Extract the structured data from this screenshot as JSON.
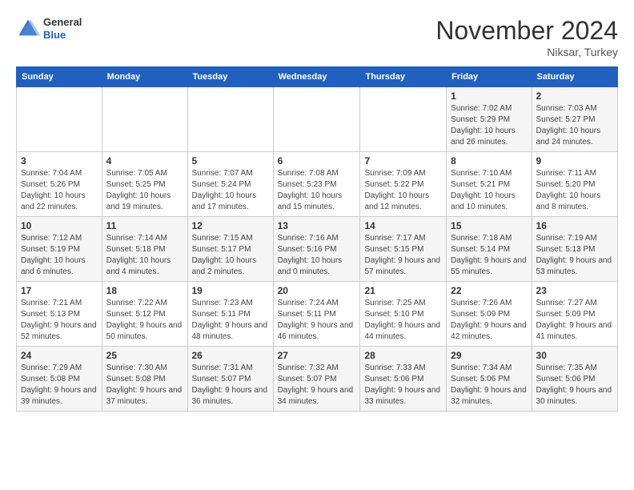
{
  "logo": {
    "general": "General",
    "blue": "Blue"
  },
  "header": {
    "month": "November 2024",
    "location": "Niksar, Turkey"
  },
  "weekdays": [
    "Sunday",
    "Monday",
    "Tuesday",
    "Wednesday",
    "Thursday",
    "Friday",
    "Saturday"
  ],
  "weeks": [
    [
      {
        "day": "",
        "info": ""
      },
      {
        "day": "",
        "info": ""
      },
      {
        "day": "",
        "info": ""
      },
      {
        "day": "",
        "info": ""
      },
      {
        "day": "",
        "info": ""
      },
      {
        "day": "1",
        "info": "Sunrise: 7:02 AM\nSunset: 5:29 PM\nDaylight: 10 hours and 26 minutes."
      },
      {
        "day": "2",
        "info": "Sunrise: 7:03 AM\nSunset: 5:27 PM\nDaylight: 10 hours and 24 minutes."
      }
    ],
    [
      {
        "day": "3",
        "info": "Sunrise: 7:04 AM\nSunset: 5:26 PM\nDaylight: 10 hours and 22 minutes."
      },
      {
        "day": "4",
        "info": "Sunrise: 7:05 AM\nSunset: 5:25 PM\nDaylight: 10 hours and 19 minutes."
      },
      {
        "day": "5",
        "info": "Sunrise: 7:07 AM\nSunset: 5:24 PM\nDaylight: 10 hours and 17 minutes."
      },
      {
        "day": "6",
        "info": "Sunrise: 7:08 AM\nSunset: 5:23 PM\nDaylight: 10 hours and 15 minutes."
      },
      {
        "day": "7",
        "info": "Sunrise: 7:09 AM\nSunset: 5:22 PM\nDaylight: 10 hours and 12 minutes."
      },
      {
        "day": "8",
        "info": "Sunrise: 7:10 AM\nSunset: 5:21 PM\nDaylight: 10 hours and 10 minutes."
      },
      {
        "day": "9",
        "info": "Sunrise: 7:11 AM\nSunset: 5:20 PM\nDaylight: 10 hours and 8 minutes."
      }
    ],
    [
      {
        "day": "10",
        "info": "Sunrise: 7:12 AM\nSunset: 5:19 PM\nDaylight: 10 hours and 6 minutes."
      },
      {
        "day": "11",
        "info": "Sunrise: 7:14 AM\nSunset: 5:18 PM\nDaylight: 10 hours and 4 minutes."
      },
      {
        "day": "12",
        "info": "Sunrise: 7:15 AM\nSunset: 5:17 PM\nDaylight: 10 hours and 2 minutes."
      },
      {
        "day": "13",
        "info": "Sunrise: 7:16 AM\nSunset: 5:16 PM\nDaylight: 10 hours and 0 minutes."
      },
      {
        "day": "14",
        "info": "Sunrise: 7:17 AM\nSunset: 5:15 PM\nDaylight: 9 hours and 57 minutes."
      },
      {
        "day": "15",
        "info": "Sunrise: 7:18 AM\nSunset: 5:14 PM\nDaylight: 9 hours and 55 minutes."
      },
      {
        "day": "16",
        "info": "Sunrise: 7:19 AM\nSunset: 5:13 PM\nDaylight: 9 hours and 53 minutes."
      }
    ],
    [
      {
        "day": "17",
        "info": "Sunrise: 7:21 AM\nSunset: 5:13 PM\nDaylight: 9 hours and 52 minutes."
      },
      {
        "day": "18",
        "info": "Sunrise: 7:22 AM\nSunset: 5:12 PM\nDaylight: 9 hours and 50 minutes."
      },
      {
        "day": "19",
        "info": "Sunrise: 7:23 AM\nSunset: 5:11 PM\nDaylight: 9 hours and 48 minutes."
      },
      {
        "day": "20",
        "info": "Sunrise: 7:24 AM\nSunset: 5:11 PM\nDaylight: 9 hours and 46 minutes."
      },
      {
        "day": "21",
        "info": "Sunrise: 7:25 AM\nSunset: 5:10 PM\nDaylight: 9 hours and 44 minutes."
      },
      {
        "day": "22",
        "info": "Sunrise: 7:26 AM\nSunset: 5:09 PM\nDaylight: 9 hours and 42 minutes."
      },
      {
        "day": "23",
        "info": "Sunrise: 7:27 AM\nSunset: 5:09 PM\nDaylight: 9 hours and 41 minutes."
      }
    ],
    [
      {
        "day": "24",
        "info": "Sunrise: 7:29 AM\nSunset: 5:08 PM\nDaylight: 9 hours and 39 minutes."
      },
      {
        "day": "25",
        "info": "Sunrise: 7:30 AM\nSunset: 5:08 PM\nDaylight: 9 hours and 37 minutes."
      },
      {
        "day": "26",
        "info": "Sunrise: 7:31 AM\nSunset: 5:07 PM\nDaylight: 9 hours and 36 minutes."
      },
      {
        "day": "27",
        "info": "Sunrise: 7:32 AM\nSunset: 5:07 PM\nDaylight: 9 hours and 34 minutes."
      },
      {
        "day": "28",
        "info": "Sunrise: 7:33 AM\nSunset: 5:06 PM\nDaylight: 9 hours and 33 minutes."
      },
      {
        "day": "29",
        "info": "Sunrise: 7:34 AM\nSunset: 5:06 PM\nDaylight: 9 hours and 32 minutes."
      },
      {
        "day": "30",
        "info": "Sunrise: 7:35 AM\nSunset: 5:06 PM\nDaylight: 9 hours and 30 minutes."
      }
    ]
  ]
}
